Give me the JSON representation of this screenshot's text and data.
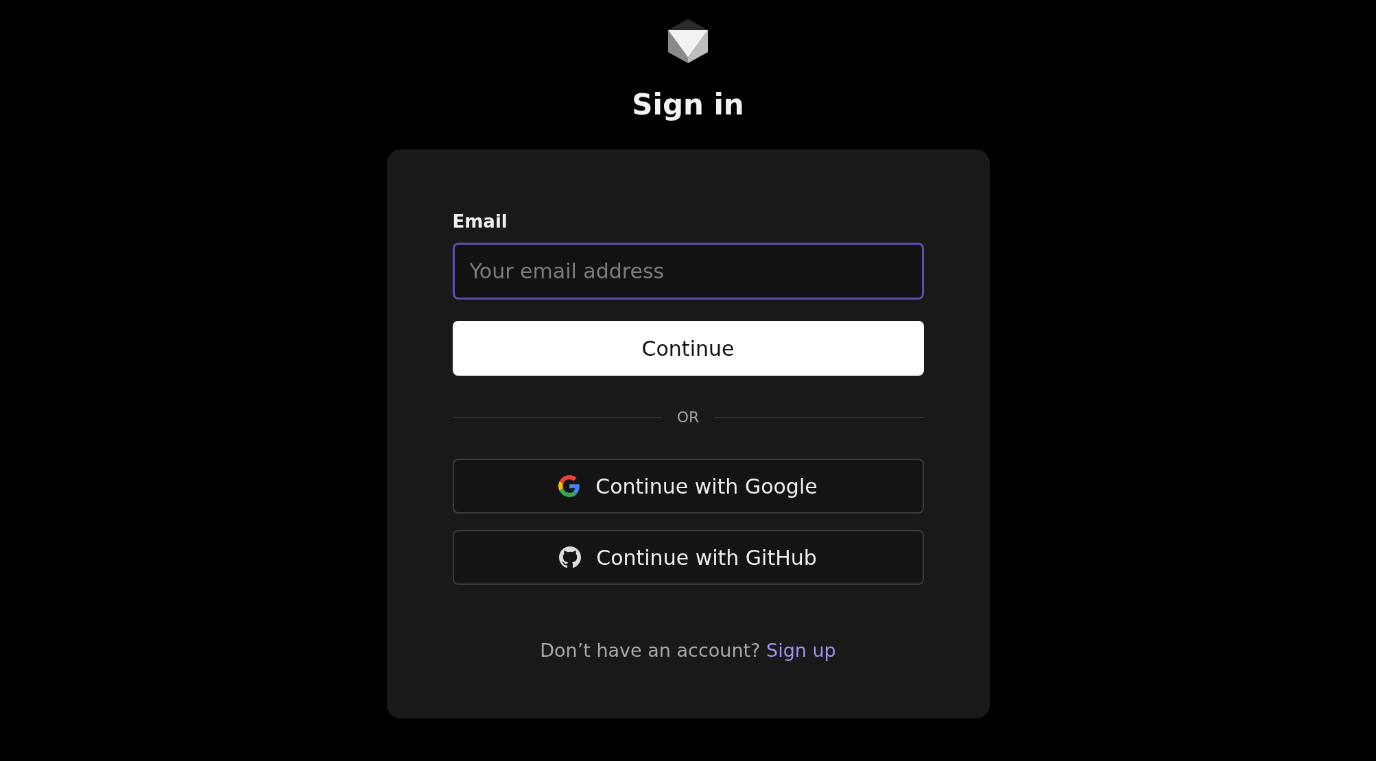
{
  "title": "Sign in",
  "email_field": {
    "label": "Email",
    "placeholder": "Your email address",
    "focused": true
  },
  "continue_button": "Continue",
  "divider": "OR",
  "providers": [
    {
      "kind": "google",
      "label": "Continue with Google"
    },
    {
      "kind": "github",
      "label": "Continue with GitHub"
    }
  ],
  "footer": {
    "text": "Don’t have an account?",
    "link": "Sign up"
  }
}
